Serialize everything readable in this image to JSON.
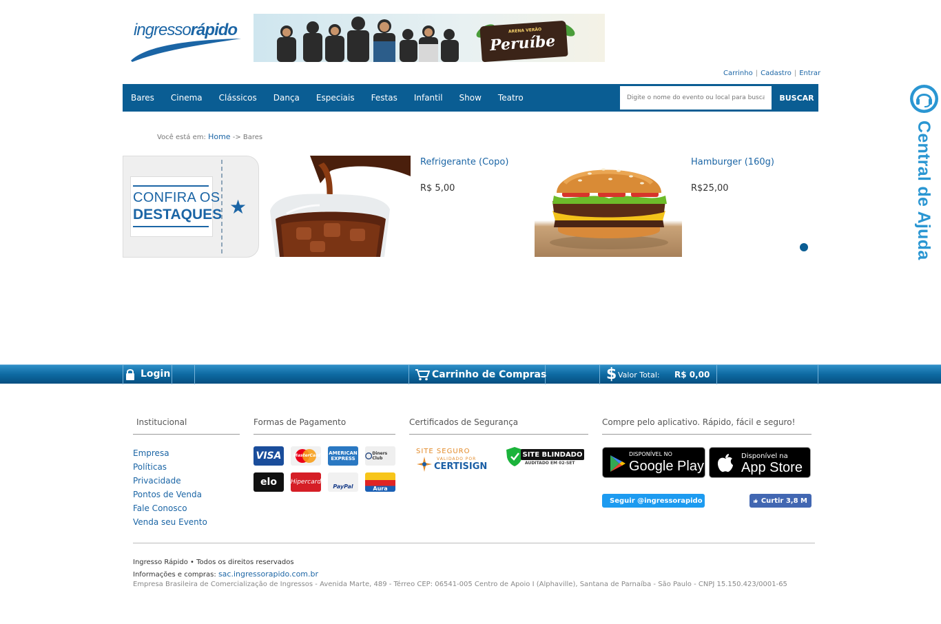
{
  "header": {
    "logo_text_regular": "ingresso",
    "logo_text_bold": "rápido",
    "banner_brand": "Peruíbe",
    "banner_brand_sub": "ARENA VERÃO",
    "user_links": [
      "Carrinho",
      "Cadastro",
      "Entrar"
    ]
  },
  "nav": {
    "items": [
      "Bares",
      "Cinema",
      "Clássicos",
      "Dança",
      "Especiais",
      "Festas",
      "Infantil",
      "Show",
      "Teatro"
    ],
    "search_placeholder": "Digite o nome do evento ou local para busca",
    "search_button": "BUSCAR"
  },
  "breadcrumb": {
    "prefix": "Você está em:",
    "home": "Home",
    "current": "-> Bares"
  },
  "highlights": {
    "line1": "CONFIRA OS",
    "line2": "DESTAQUES"
  },
  "products": [
    {
      "name": "Refrigerante (Copo)",
      "price": "R$ 5,00"
    },
    {
      "name": "Hamburger (160g)",
      "price": "R$25,00"
    }
  ],
  "help": {
    "label": "Central de Ajuda"
  },
  "bottom_bar": {
    "login": "Login",
    "cart": "Carrinho de Compras",
    "total_label": "Valor Total:",
    "total_value": "R$ 0,00"
  },
  "footer": {
    "institucional_title": "Institucional",
    "institucional_links": [
      "Empresa",
      "Políticas",
      "Privacidade",
      "Pontos de Venda",
      "Fale Conosco",
      "Venda seu Evento"
    ],
    "payments_title": "Formas de Pagamento",
    "payments": [
      "VISA",
      "MasterCard",
      "AMERICAN EXPRESS",
      "Diners Club",
      "elo",
      "Hipercard",
      "PayPal",
      "Aura"
    ],
    "security_title": "Certificados de Segurança",
    "cert_site_line1": "SITE SEGURO",
    "cert_site_line2": "VALIDADO POR",
    "cert_site_line3": "CERTISIGN",
    "cert_blind_line1": "SITE BLINDADO",
    "cert_blind_line2": "AUDITADO EM 02-SET",
    "app_title": "Compre pelo aplicativo. Rápido, fácil e seguro!",
    "google_small": "DISPONÍVEL NO",
    "google_big": "Google Play",
    "apple_small": "Disponível na",
    "apple_big": "App Store",
    "twitter": "Seguir @ingressorapido",
    "facebook": "Curtir 3,8 M",
    "rights": "Ingresso Rápido • Todos os direitos reservados",
    "info_prefix": "Informações e compras:",
    "info_link": "sac.ingressorapido.com.br",
    "address": "Empresa Brasileira de Comercialização de Ingressos - Avenida Marte, 489 - Térreo CEP: 06541-005 Centro de Apoio I (Alphaville), Santana de Parnaíba - São Paulo - CNPJ 15.150.423/0001-65"
  },
  "colors": {
    "brand_blue": "#0a5d93",
    "link_blue": "#1b65a5",
    "help_blue": "#2a96d2"
  }
}
